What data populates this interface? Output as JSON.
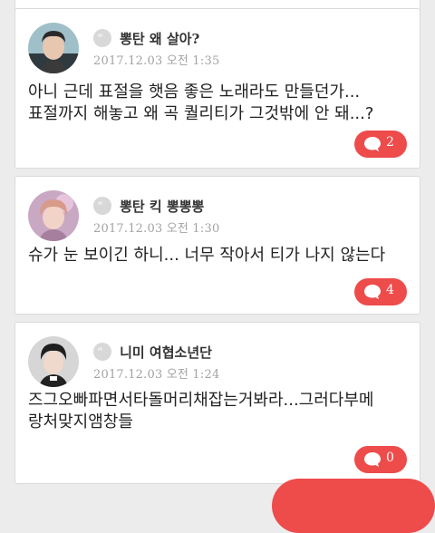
{
  "posts": [
    {
      "title": "뽕탄 왜 살아?",
      "date": "2017.12.03 오전 1:35",
      "lines": [
        "아니 근데 표절을 햇음 좋은 노래라도 만들던가...",
        "표절까지 해놓고 왜 곡 퀄리티가 그것밖에 안 돼...?"
      ],
      "comment_count": "2",
      "avatar_icon": "person-avatar-icon"
    },
    {
      "title": "뽕탄 킥 뽕뽕뽕",
      "date": "2017.12.03 오전 1:30",
      "lines": [
        "슈가 눈 보이긴 하니... 너무 작아서 티가 나지 않는다"
      ],
      "comment_count": "4",
      "avatar_icon": "person-avatar-icon"
    },
    {
      "title": "니미 여협소년단",
      "date": "2017.12.03 오전 1:24",
      "lines": [
        "즈그오빠파면서타돌머리채잡는거봐라...그러다부메",
        "랑처맞지앰창들"
      ],
      "comment_count": "0",
      "avatar_icon": "person-avatar-icon"
    }
  ],
  "colors": {
    "accent": "#ee4b4b",
    "background": "#ececec",
    "card": "#ffffff",
    "date_text": "#a3a3a3"
  },
  "icons": {
    "quote": "quote-icon",
    "comment": "comment-bubble-icon"
  }
}
